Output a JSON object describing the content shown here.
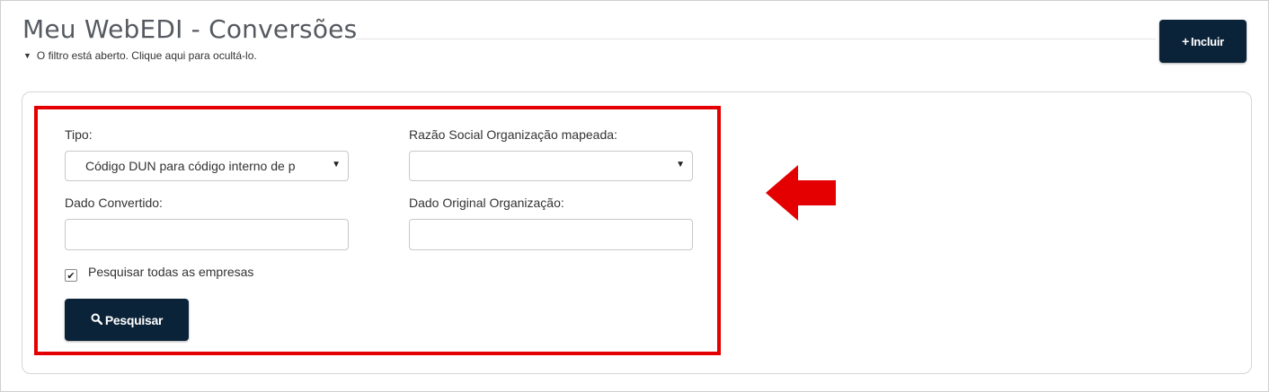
{
  "header": {
    "title": "Meu WebEDI - Conversões",
    "filter_toggle_text": "O filtro está aberto. Clique aqui para ocultá-lo.",
    "include_label": "Incluir"
  },
  "filter": {
    "tipo_label": "Tipo:",
    "tipo_value": "Código DUN para código interno de p",
    "razao_label": "Razão Social Organização mapeada:",
    "razao_value": "",
    "dado_convertido_label": "Dado Convertido:",
    "dado_convertido_value": "",
    "dado_original_label": "Dado Original Organização:",
    "dado_original_value": "",
    "all_companies_label": "Pesquisar todas as empresas",
    "all_companies_checked": true,
    "search_label": "Pesquisar"
  },
  "annotation": {
    "highlight_color": "#e40000",
    "arrow_color": "#e40000"
  },
  "icons": {
    "plus": "plus-icon",
    "search": "search-icon",
    "chevron": "chevron-down-icon",
    "caret": "caret-down-icon",
    "arrow": "left-arrow-icon"
  }
}
